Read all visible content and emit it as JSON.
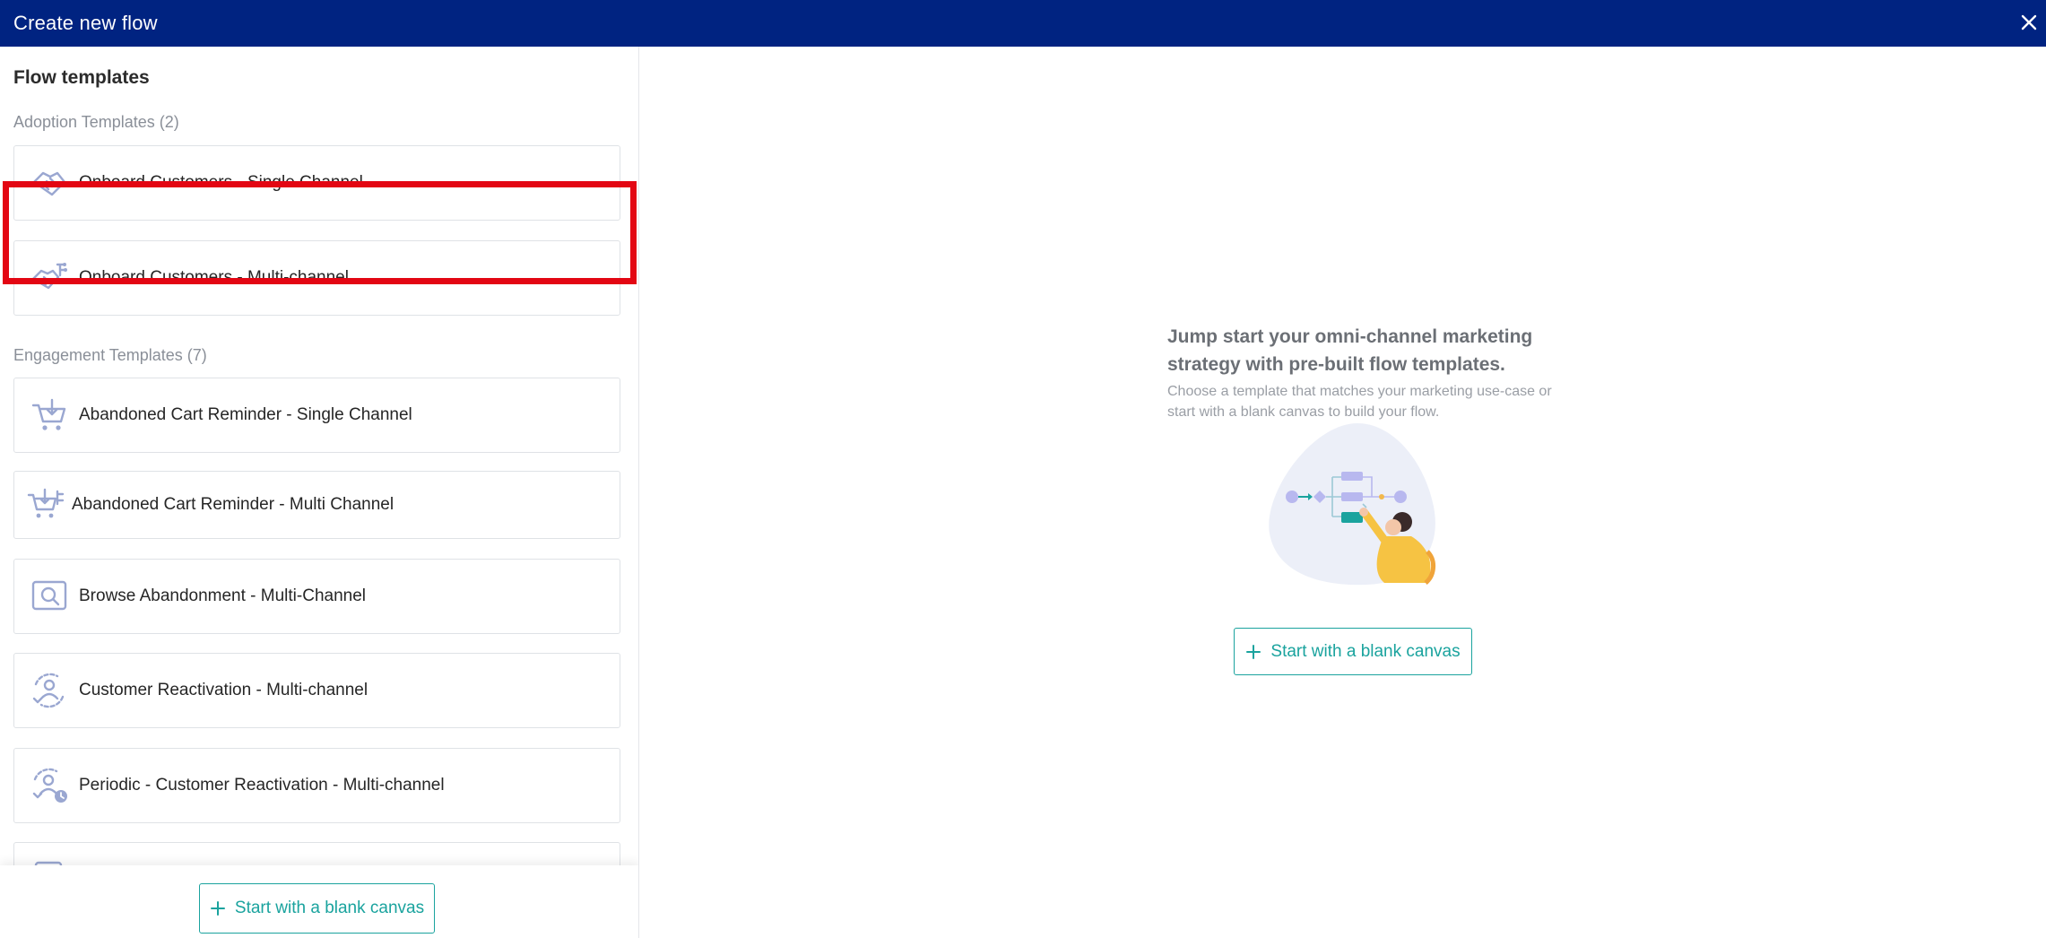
{
  "header": {
    "title": "Create new flow",
    "close_icon": "close-icon"
  },
  "left_panel": {
    "title": "Flow templates",
    "sections": [
      {
        "title": "Adoption Templates (2)",
        "items": [
          {
            "label": "Onboard Customers - Single Channel",
            "icon": "handshake-icon"
          },
          {
            "label": "Onboard Customers - Multi-channel",
            "icon": "handshake-branch-icon",
            "highlighted": true
          }
        ]
      },
      {
        "title": "Engagement Templates (7)",
        "items": [
          {
            "label": "Abandoned Cart Reminder - Single Channel",
            "icon": "cart-icon"
          },
          {
            "label": "Abandoned Cart Reminder - Multi Channel",
            "icon": "cart-branch-icon"
          },
          {
            "label": "Browse Abandonment - Multi-Channel",
            "icon": "browse-search-icon"
          },
          {
            "label": "Customer Reactivation - Multi-channel",
            "icon": "user-refresh-icon"
          },
          {
            "label": "Periodic - Customer Reactivation - Multi-channel",
            "icon": "user-refresh-clock-icon"
          }
        ]
      }
    ],
    "blank_canvas_label": "Start with a blank canvas"
  },
  "right_panel": {
    "heading": "Jump start your omni-channel marketing strategy with pre-built flow templates.",
    "subtext": "Choose a template that matches your marketing use-case or start with a blank canvas to build your flow.",
    "blank_canvas_label": "Start with a blank canvas"
  },
  "colors": {
    "header_bg": "#002381",
    "accent": "#1aa39e",
    "highlight": "#e30613",
    "icon": "#9aa7d1"
  }
}
